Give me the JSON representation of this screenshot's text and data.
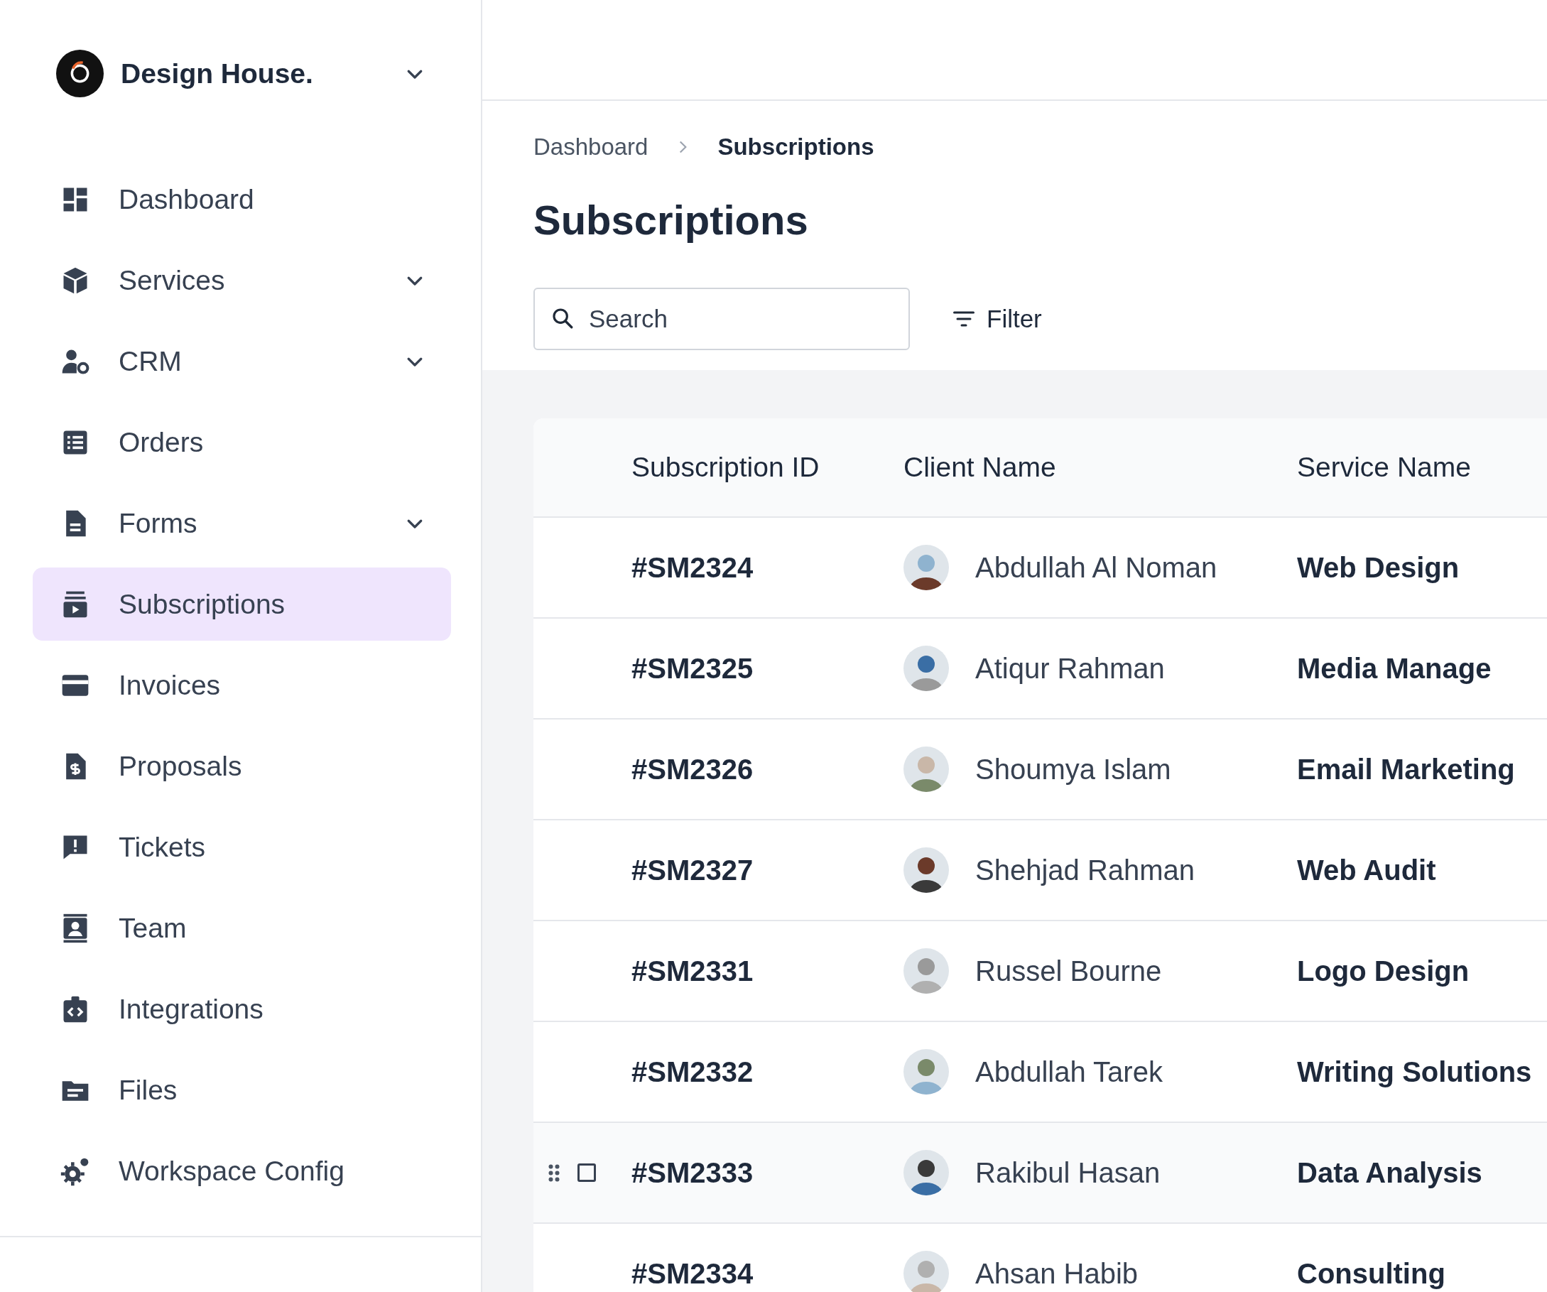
{
  "workspace": {
    "name": "Design House."
  },
  "sidebar": {
    "items": [
      {
        "label": "Dashboard",
        "kind": "dashboard",
        "expandable": false,
        "selected": false
      },
      {
        "label": "Services",
        "kind": "box",
        "expandable": true,
        "selected": false
      },
      {
        "label": "CRM",
        "kind": "user-gear",
        "expandable": true,
        "selected": false
      },
      {
        "label": "Orders",
        "kind": "list",
        "expandable": false,
        "selected": false
      },
      {
        "label": "Forms",
        "kind": "document",
        "expandable": true,
        "selected": false
      },
      {
        "label": "Subscriptions",
        "kind": "play-stack",
        "expandable": false,
        "selected": true
      },
      {
        "label": "Invoices",
        "kind": "card",
        "expandable": false,
        "selected": false
      },
      {
        "label": "Proposals",
        "kind": "dollar-doc",
        "expandable": false,
        "selected": false
      },
      {
        "label": "Tickets",
        "kind": "alert",
        "expandable": false,
        "selected": false
      },
      {
        "label": "Team",
        "kind": "contact",
        "expandable": false,
        "selected": false
      },
      {
        "label": "Integrations",
        "kind": "code",
        "expandable": false,
        "selected": false
      },
      {
        "label": "Files",
        "kind": "folder",
        "expandable": false,
        "selected": false
      },
      {
        "label": "Workspace Config",
        "kind": "gears",
        "expandable": false,
        "selected": false
      }
    ]
  },
  "breadcrumb": [
    "Dashboard",
    "Subscriptions"
  ],
  "page_title": "Subscriptions",
  "search": {
    "placeholder": "Search"
  },
  "filter_button": "Filter",
  "table": {
    "columns": [
      "Subscription ID",
      "Client Name",
      "Service Name"
    ],
    "rows": [
      {
        "id": "#SM2324",
        "client": "Abdullah Al Noman",
        "service": "Web Design",
        "hovered": false,
        "checked": false
      },
      {
        "id": "#SM2325",
        "client": "Atiqur Rahman",
        "service": "Media Manage",
        "hovered": false,
        "checked": false
      },
      {
        "id": "#SM2326",
        "client": "Shoumya Islam",
        "service": "Email Marketing",
        "hovered": false,
        "checked": false
      },
      {
        "id": "#SM2327",
        "client": "Shehjad Rahman",
        "service": "Web Audit",
        "hovered": false,
        "checked": false
      },
      {
        "id": "#SM2331",
        "client": "Russel Bourne",
        "service": "Logo Design",
        "hovered": false,
        "checked": false
      },
      {
        "id": "#SM2332",
        "client": "Abdullah Tarek",
        "service": "Writing Solutions",
        "hovered": false,
        "checked": false
      },
      {
        "id": "#SM2333",
        "client": "Rakibul Hasan",
        "service": "Data Analysis",
        "hovered": true,
        "checked": false
      },
      {
        "id": "#SM2334",
        "client": "Ahsan Habib",
        "service": "Consulting",
        "hovered": false,
        "checked": false
      }
    ]
  }
}
